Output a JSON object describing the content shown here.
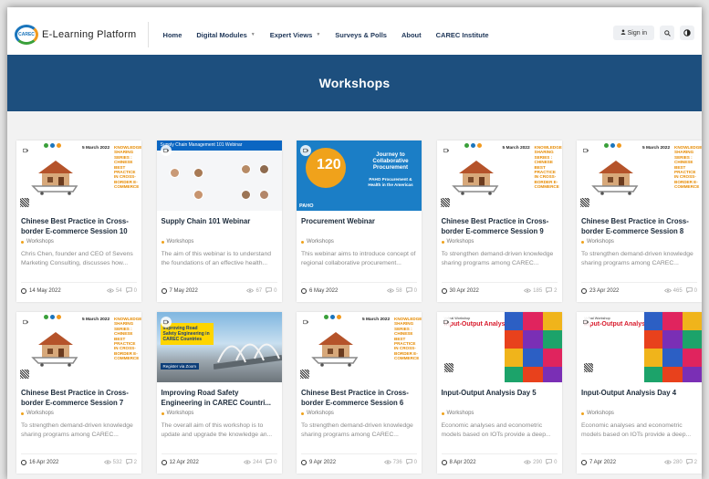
{
  "nav": {
    "brand": "E-Learning Platform",
    "logo_text": "CAREC",
    "items": [
      {
        "label": "Home",
        "has_caret": false
      },
      {
        "label": "Digital Modules",
        "has_caret": true
      },
      {
        "label": "Expert Views",
        "has_caret": true
      },
      {
        "label": "Surveys & Polls",
        "has_caret": false
      },
      {
        "label": "About",
        "has_caret": false
      },
      {
        "label": "CAREC Institute",
        "has_caret": false
      }
    ],
    "signin_label": "Sign in",
    "search_icon": "search-icon",
    "theme_icon": "contrast-icon"
  },
  "hero": {
    "title": "Workshops",
    "bg_color": "#1d4f7e"
  },
  "colors": {
    "accent": "#f0a21b",
    "title": "#1b2a3a",
    "nav_text": "#1d3557"
  },
  "thumb_text": {
    "ecom_date": "5 March 2022",
    "ecom_series": "KNOWLEDGE SHARING SERIES : CHINESE BEST PRACTICE IN CROSS-BORDER E-COMMERCE",
    "scm_banner": "Supply Chain Management 101 Webinar",
    "paho_title": "Journey to Collaborative Procurement",
    "paho_sub": "PAHO Procurement & Health in the Americas",
    "paho_logo": "PAHO",
    "road_text": "Improving Road Safety Engineering in CAREC Countries",
    "road_reg": "Register via Zoom",
    "io_workshop": "Virtual Workshop",
    "io_title": "Input-Output Analysis"
  },
  "cards": [
    {
      "title": "Chinese Best Practice in Cross-border E-commerce Session 10",
      "category": "Workshops",
      "desc": "Chris Chen, founder and CEO of Sevens Marketing Consulting, discusses how...",
      "date": "14 May 2022",
      "views": "54",
      "comments": "0",
      "thumb": "ecom"
    },
    {
      "title": "Supply Chain 101 Webinar",
      "category": "Workshops",
      "desc": "The aim of this webinar is to understand the foundations of an effective health...",
      "date": "7 May 2022",
      "views": "67",
      "comments": "0",
      "thumb": "scm"
    },
    {
      "title": "Procurement Webinar",
      "category": "Workshops",
      "desc": "This webinar aims to introduce concept of regional collaborative procurement...",
      "date": "6 May 2022",
      "views": "58",
      "comments": "0",
      "thumb": "paho"
    },
    {
      "title": "Chinese Best Practice in Cross-border E-commerce Session 9",
      "category": "Workshops",
      "desc": "To strengthen demand-driven knowledge sharing programs among CAREC...",
      "date": "30 Apr 2022",
      "views": "185",
      "comments": "2",
      "thumb": "ecom"
    },
    {
      "title": "Chinese Best Practice in Cross-border E-commerce Session 8",
      "category": "Workshops",
      "desc": "To strengthen demand-driven knowledge sharing programs among CAREC...",
      "date": "23 Apr 2022",
      "views": "465",
      "comments": "0",
      "thumb": "ecom"
    },
    {
      "title": "Chinese Best Practice in Cross-border E-commerce Session 7",
      "category": "Workshops",
      "desc": "To strengthen demand-driven knowledge sharing programs among CAREC...",
      "date": "16 Apr 2022",
      "views": "532",
      "comments": "2",
      "thumb": "ecom"
    },
    {
      "title": "Improving Road Safety Engineering in CAREC Countri...",
      "category": "Workshops",
      "desc": "The overall aim of this workshop is to update and upgrade the knowledge an...",
      "date": "12 Apr 2022",
      "views": "244",
      "comments": "0",
      "thumb": "road"
    },
    {
      "title": "Chinese Best Practice in Cross-border E-commerce Session 6",
      "category": "Workshops",
      "desc": "To strengthen demand-driven knowledge sharing programs among CAREC...",
      "date": "9 Apr 2022",
      "views": "736",
      "comments": "0",
      "thumb": "ecom"
    },
    {
      "title": "Input-Output Analysis Day 5",
      "category": "Workshops",
      "desc": "Economic analyses and econometric models based on IOTs provide a deep...",
      "date": "8 Apr 2022",
      "views": "290",
      "comments": "0",
      "thumb": "io"
    },
    {
      "title": "Input-Output Analysis Day 4",
      "category": "Workshops",
      "desc": "Economic analyses and econometric models based on IOTs provide a deep...",
      "date": "7 Apr 2022",
      "views": "280",
      "comments": "2",
      "thumb": "io"
    }
  ]
}
